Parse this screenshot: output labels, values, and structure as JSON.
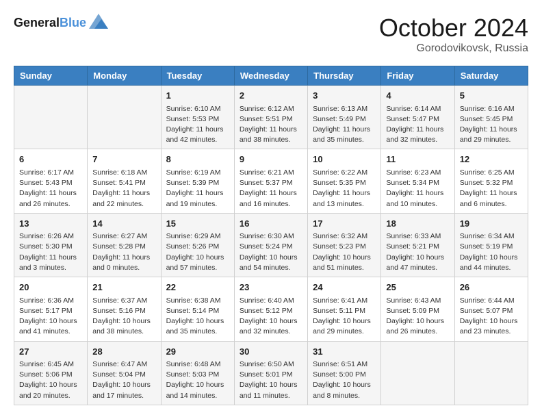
{
  "header": {
    "logo_line1": "General",
    "logo_line2": "Blue",
    "title": "October 2024",
    "location": "Gorodovikovsk, Russia"
  },
  "weekdays": [
    "Sunday",
    "Monday",
    "Tuesday",
    "Wednesday",
    "Thursday",
    "Friday",
    "Saturday"
  ],
  "weeks": [
    [
      {
        "day": "",
        "sunrise": "",
        "sunset": "",
        "daylight": ""
      },
      {
        "day": "",
        "sunrise": "",
        "sunset": "",
        "daylight": ""
      },
      {
        "day": "1",
        "sunrise": "Sunrise: 6:10 AM",
        "sunset": "Sunset: 5:53 PM",
        "daylight": "Daylight: 11 hours and 42 minutes."
      },
      {
        "day": "2",
        "sunrise": "Sunrise: 6:12 AM",
        "sunset": "Sunset: 5:51 PM",
        "daylight": "Daylight: 11 hours and 38 minutes."
      },
      {
        "day": "3",
        "sunrise": "Sunrise: 6:13 AM",
        "sunset": "Sunset: 5:49 PM",
        "daylight": "Daylight: 11 hours and 35 minutes."
      },
      {
        "day": "4",
        "sunrise": "Sunrise: 6:14 AM",
        "sunset": "Sunset: 5:47 PM",
        "daylight": "Daylight: 11 hours and 32 minutes."
      },
      {
        "day": "5",
        "sunrise": "Sunrise: 6:16 AM",
        "sunset": "Sunset: 5:45 PM",
        "daylight": "Daylight: 11 hours and 29 minutes."
      }
    ],
    [
      {
        "day": "6",
        "sunrise": "Sunrise: 6:17 AM",
        "sunset": "Sunset: 5:43 PM",
        "daylight": "Daylight: 11 hours and 26 minutes."
      },
      {
        "day": "7",
        "sunrise": "Sunrise: 6:18 AM",
        "sunset": "Sunset: 5:41 PM",
        "daylight": "Daylight: 11 hours and 22 minutes."
      },
      {
        "day": "8",
        "sunrise": "Sunrise: 6:19 AM",
        "sunset": "Sunset: 5:39 PM",
        "daylight": "Daylight: 11 hours and 19 minutes."
      },
      {
        "day": "9",
        "sunrise": "Sunrise: 6:21 AM",
        "sunset": "Sunset: 5:37 PM",
        "daylight": "Daylight: 11 hours and 16 minutes."
      },
      {
        "day": "10",
        "sunrise": "Sunrise: 6:22 AM",
        "sunset": "Sunset: 5:35 PM",
        "daylight": "Daylight: 11 hours and 13 minutes."
      },
      {
        "day": "11",
        "sunrise": "Sunrise: 6:23 AM",
        "sunset": "Sunset: 5:34 PM",
        "daylight": "Daylight: 11 hours and 10 minutes."
      },
      {
        "day": "12",
        "sunrise": "Sunrise: 6:25 AM",
        "sunset": "Sunset: 5:32 PM",
        "daylight": "Daylight: 11 hours and 6 minutes."
      }
    ],
    [
      {
        "day": "13",
        "sunrise": "Sunrise: 6:26 AM",
        "sunset": "Sunset: 5:30 PM",
        "daylight": "Daylight: 11 hours and 3 minutes."
      },
      {
        "day": "14",
        "sunrise": "Sunrise: 6:27 AM",
        "sunset": "Sunset: 5:28 PM",
        "daylight": "Daylight: 11 hours and 0 minutes."
      },
      {
        "day": "15",
        "sunrise": "Sunrise: 6:29 AM",
        "sunset": "Sunset: 5:26 PM",
        "daylight": "Daylight: 10 hours and 57 minutes."
      },
      {
        "day": "16",
        "sunrise": "Sunrise: 6:30 AM",
        "sunset": "Sunset: 5:24 PM",
        "daylight": "Daylight: 10 hours and 54 minutes."
      },
      {
        "day": "17",
        "sunrise": "Sunrise: 6:32 AM",
        "sunset": "Sunset: 5:23 PM",
        "daylight": "Daylight: 10 hours and 51 minutes."
      },
      {
        "day": "18",
        "sunrise": "Sunrise: 6:33 AM",
        "sunset": "Sunset: 5:21 PM",
        "daylight": "Daylight: 10 hours and 47 minutes."
      },
      {
        "day": "19",
        "sunrise": "Sunrise: 6:34 AM",
        "sunset": "Sunset: 5:19 PM",
        "daylight": "Daylight: 10 hours and 44 minutes."
      }
    ],
    [
      {
        "day": "20",
        "sunrise": "Sunrise: 6:36 AM",
        "sunset": "Sunset: 5:17 PM",
        "daylight": "Daylight: 10 hours and 41 minutes."
      },
      {
        "day": "21",
        "sunrise": "Sunrise: 6:37 AM",
        "sunset": "Sunset: 5:16 PM",
        "daylight": "Daylight: 10 hours and 38 minutes."
      },
      {
        "day": "22",
        "sunrise": "Sunrise: 6:38 AM",
        "sunset": "Sunset: 5:14 PM",
        "daylight": "Daylight: 10 hours and 35 minutes."
      },
      {
        "day": "23",
        "sunrise": "Sunrise: 6:40 AM",
        "sunset": "Sunset: 5:12 PM",
        "daylight": "Daylight: 10 hours and 32 minutes."
      },
      {
        "day": "24",
        "sunrise": "Sunrise: 6:41 AM",
        "sunset": "Sunset: 5:11 PM",
        "daylight": "Daylight: 10 hours and 29 minutes."
      },
      {
        "day": "25",
        "sunrise": "Sunrise: 6:43 AM",
        "sunset": "Sunset: 5:09 PM",
        "daylight": "Daylight: 10 hours and 26 minutes."
      },
      {
        "day": "26",
        "sunrise": "Sunrise: 6:44 AM",
        "sunset": "Sunset: 5:07 PM",
        "daylight": "Daylight: 10 hours and 23 minutes."
      }
    ],
    [
      {
        "day": "27",
        "sunrise": "Sunrise: 6:45 AM",
        "sunset": "Sunset: 5:06 PM",
        "daylight": "Daylight: 10 hours and 20 minutes."
      },
      {
        "day": "28",
        "sunrise": "Sunrise: 6:47 AM",
        "sunset": "Sunset: 5:04 PM",
        "daylight": "Daylight: 10 hours and 17 minutes."
      },
      {
        "day": "29",
        "sunrise": "Sunrise: 6:48 AM",
        "sunset": "Sunset: 5:03 PM",
        "daylight": "Daylight: 10 hours and 14 minutes."
      },
      {
        "day": "30",
        "sunrise": "Sunrise: 6:50 AM",
        "sunset": "Sunset: 5:01 PM",
        "daylight": "Daylight: 10 hours and 11 minutes."
      },
      {
        "day": "31",
        "sunrise": "Sunrise: 6:51 AM",
        "sunset": "Sunset: 5:00 PM",
        "daylight": "Daylight: 10 hours and 8 minutes."
      },
      {
        "day": "",
        "sunrise": "",
        "sunset": "",
        "daylight": ""
      },
      {
        "day": "",
        "sunrise": "",
        "sunset": "",
        "daylight": ""
      }
    ]
  ]
}
